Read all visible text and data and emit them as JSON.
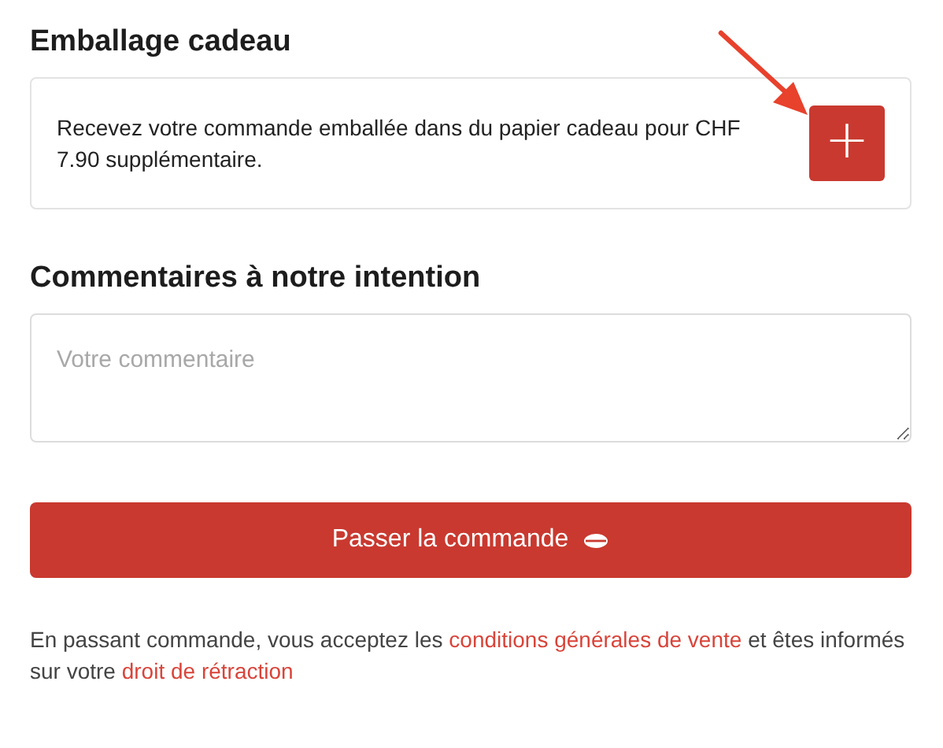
{
  "gift_wrap": {
    "heading": "Emballage cadeau",
    "description": "Recevez votre commande emballée dans du papier cadeau pour CHF 7.90 supplémentaire.",
    "add_button": "+"
  },
  "comments": {
    "heading": "Commentaires à notre intention",
    "placeholder": "Votre commentaire"
  },
  "order_button": {
    "label": "Passer la commande"
  },
  "legal": {
    "parts": [
      {
        "kind": "text",
        "text": "En passant commande, vous acceptez les "
      },
      {
        "kind": "link",
        "text": "conditions générales de vente"
      },
      {
        "kind": "text",
        "text": " et êtes informés sur votre "
      },
      {
        "kind": "link",
        "text": "droit de rétraction"
      }
    ]
  }
}
